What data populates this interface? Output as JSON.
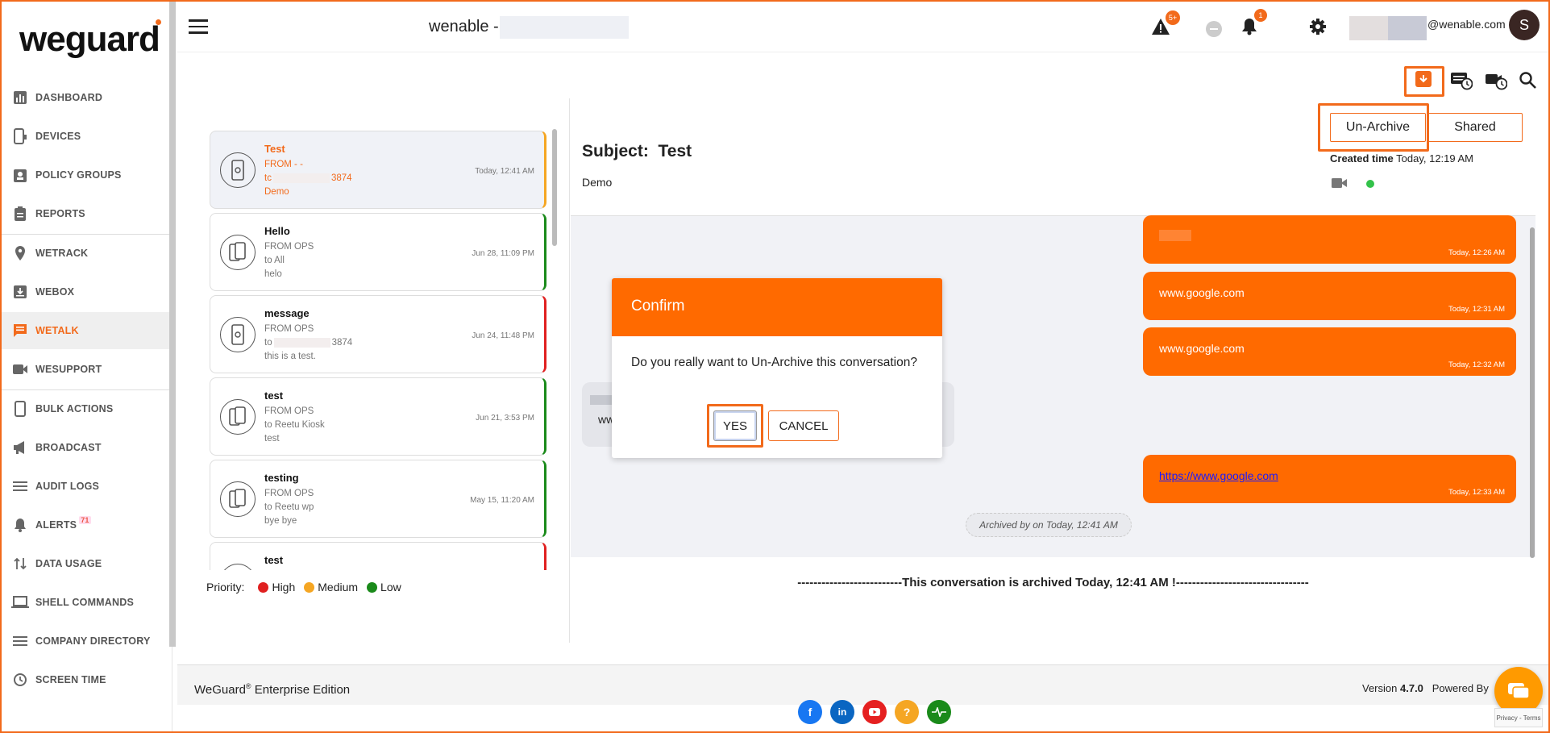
{
  "brand": {
    "logo": "weguard"
  },
  "sidebar": {
    "items": [
      {
        "label": "DASHBOARD",
        "icon": "dashboard-icon"
      },
      {
        "label": "DEVICES",
        "icon": "devices-icon"
      },
      {
        "label": "POLICY GROUPS",
        "icon": "policy-groups-icon"
      },
      {
        "label": "REPORTS",
        "icon": "reports-icon"
      },
      {
        "label": "WETRACK",
        "icon": "location-pin-icon"
      },
      {
        "label": "WEBOX",
        "icon": "webox-icon"
      },
      {
        "label": "WETALK",
        "icon": "chat-icon"
      },
      {
        "label": "WESUPPORT",
        "icon": "video-camera-icon"
      },
      {
        "label": "BULK ACTIONS",
        "icon": "phone-icon"
      },
      {
        "label": "BROADCAST",
        "icon": "megaphone-icon"
      },
      {
        "label": "AUDIT LOGS",
        "icon": "list-icon"
      },
      {
        "label": "ALERTS",
        "icon": "alert-bell-icon",
        "badge": "71"
      },
      {
        "label": "DATA USAGE",
        "icon": "data-arrows-icon"
      },
      {
        "label": "SHELL COMMANDS",
        "icon": "laptop-icon"
      },
      {
        "label": "COMPANY DIRECTORY",
        "icon": "directory-icon"
      },
      {
        "label": "SCREEN TIME",
        "icon": "history-icon"
      }
    ]
  },
  "topbar": {
    "org": "wenable -",
    "warning_badge": "5+",
    "bell_badge": "1",
    "email_suffix": "@wenable.com",
    "avatar_initial": "S"
  },
  "conversations": [
    {
      "title": "Test",
      "from": "FROM - -",
      "to": "tc",
      "to_suffix": "3874",
      "msg": "Demo",
      "date": "Today, 12:41 AM"
    },
    {
      "title": "Hello",
      "from": "FROM OPS",
      "to": "to All",
      "to_suffix": "",
      "msg": "helo",
      "date": "Jun 28, 11:09 PM"
    },
    {
      "title": "message",
      "from": "FROM OPS",
      "to": "to",
      "to_suffix": "3874",
      "msg": "this is a test.",
      "date": "Jun 24, 11:48 PM"
    },
    {
      "title": "test",
      "from": "FROM OPS",
      "to": "to Reetu Kiosk",
      "to_suffix": "",
      "msg": "test",
      "date": "Jun 21, 3:53 PM"
    },
    {
      "title": "testing",
      "from": "FROM OPS",
      "to": "to Reetu wp",
      "to_suffix": "",
      "msg": "bye bye",
      "date": "May 15, 11:20 AM"
    },
    {
      "title": "test",
      "from": "",
      "to": "",
      "to_suffix": "",
      "msg": "",
      "date": ""
    }
  ],
  "priority": {
    "label": "Priority:",
    "high": "High",
    "medium": "Medium",
    "low": "Low",
    "colors": {
      "high": "#e02020",
      "medium": "#f5a623",
      "low": "#1a8a1a"
    }
  },
  "detail": {
    "subject_label": "Subject:",
    "subject": "Test",
    "sub": "Demo",
    "unarchive": "Un-Archive",
    "shared": "Shared",
    "created_label": "Created time",
    "created_value": "Today, 12:19 AM"
  },
  "messages": [
    {
      "text": "",
      "time": "Today, 12:26 AM"
    },
    {
      "text": "www.google.com",
      "time": "Today, 12:31 AM"
    },
    {
      "text": "www.google.com",
      "time": "Today, 12:32 AM"
    },
    {
      "text": "https://www.google.com",
      "time": "Today, 12:33 AM"
    }
  ],
  "incoming_partial": "ww",
  "archived_chip": "Archived by on Today, 12:41 AM",
  "archived_banner": "--------------------------This conversation is archived Today, 12:41 AM !---------------------------------",
  "dialog": {
    "title": "Confirm",
    "body": "Do you really want to Un-Archive this conversation?",
    "yes": "YES",
    "cancel": "CANCEL"
  },
  "footer": {
    "edition": "WeGuard",
    "reg": "®",
    "edition_suffix": " Enterprise Edition",
    "version_label": "Version",
    "version": "4.7.0",
    "powered": "Powered By",
    "recaptcha": "Privacy - Terms"
  },
  "colors": {
    "accent": "#ff6a00",
    "facebook": "#1877f2",
    "linkedin": "#0a66c2",
    "youtube": "#e52020",
    "help": "#f5a623",
    "green": "#1a8a1a"
  }
}
